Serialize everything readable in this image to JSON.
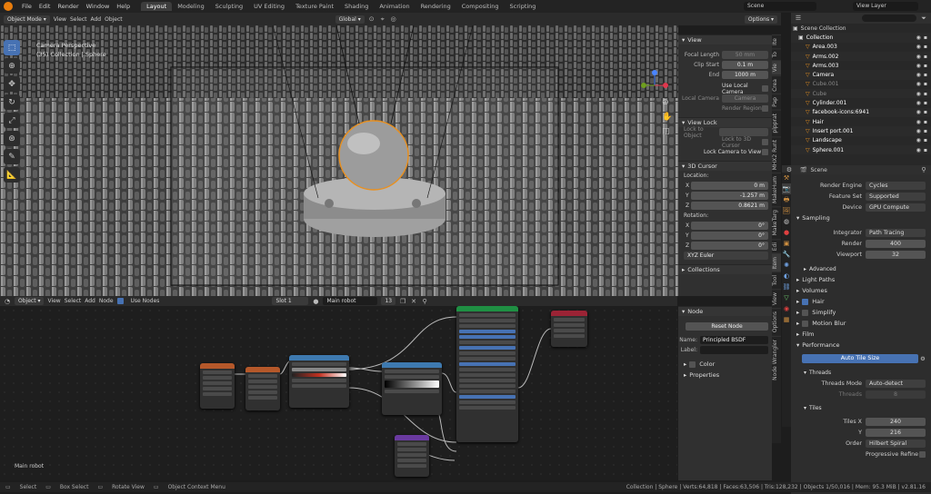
{
  "topbar": {
    "menus": [
      "File",
      "Edit",
      "Render",
      "Window",
      "Help"
    ],
    "workspaces": [
      "Layout",
      "Modeling",
      "Sculpting",
      "UV Editing",
      "Texture Paint",
      "Shading",
      "Animation",
      "Rendering",
      "Compositing",
      "Scripting"
    ],
    "active_workspace": "Layout",
    "scene": "Scene",
    "view_layer": "View Layer"
  },
  "viewport_header": {
    "mode": "Object Mode",
    "menus": [
      "View",
      "Select",
      "Add",
      "Object"
    ],
    "orientation": "Global",
    "options": "Options",
    "overlay_title": "Camera Perspective",
    "overlay_sub": "(35) Collection | Sphere"
  },
  "npanel": {
    "view_section": "View",
    "focal_length_label": "Focal Length",
    "focal_length": "50 mm",
    "clip_start_label": "Clip Start",
    "clip_start": "0.1 m",
    "end_label": "End",
    "end": "1000 m",
    "use_local_camera": "Use Local Camera",
    "local_camera_label": "Local Camera",
    "local_camera_value": "Camera",
    "render_region": "Render Region",
    "view_lock_section": "View Lock",
    "lock_to_object": "Lock to Object",
    "lock_to_3d_cursor": "Lock to 3D Cursor",
    "lock_camera_to_view": "Lock Camera to View",
    "cursor_section": "3D Cursor",
    "location_label": "Location:",
    "loc_x": "0 m",
    "loc_y": "-1.257 m",
    "loc_z": "0.8621 m",
    "rotation_label": "Rotation:",
    "rot_x": "0°",
    "rot_y": "0°",
    "rot_z": "0°",
    "rotation_mode": "XYZ Euler",
    "collections_section": "Collections"
  },
  "npanel_tabs": [
    "Ite",
    "To",
    "Vie",
    "Crea",
    "Pap",
    "plpprat",
    "MHX2 Runt",
    "MakeHum",
    "MakeTarg",
    "Edi",
    "Item",
    "Tool",
    "View",
    "Options",
    "Node Wrangler"
  ],
  "outliner": {
    "title": "Scene Collection",
    "items": [
      {
        "name": "Collection",
        "color": "#ffffff"
      },
      {
        "name": "Area.003",
        "color": "#ffffff"
      },
      {
        "name": "Arms.002",
        "color": "#ffffff"
      },
      {
        "name": "Arms.003",
        "color": "#ffffff"
      },
      {
        "name": "Camera",
        "color": "#ffffff"
      },
      {
        "name": "Cube.001",
        "color": "#888888"
      },
      {
        "name": "Cube",
        "color": "#888888"
      },
      {
        "name": "Cylinder.001",
        "color": "#ffffff"
      },
      {
        "name": "facebook-icons:6941",
        "color": "#ffffff"
      },
      {
        "name": "Hair",
        "color": "#ffffff"
      },
      {
        "name": "Insert port.001",
        "color": "#ffffff"
      },
      {
        "name": "Landscape",
        "color": "#ffffff"
      },
      {
        "name": "Sphere.001",
        "color": "#ffffff"
      }
    ]
  },
  "properties": {
    "scene": "Scene",
    "render_engine_label": "Render Engine",
    "render_engine": "Cycles",
    "feature_set_label": "Feature Set",
    "feature_set": "Supported",
    "device_label": "Device",
    "device": "GPU Compute",
    "sampling": "Sampling",
    "integrator_label": "Integrator",
    "integrator": "Path Tracing",
    "render_label": "Render",
    "render_samples": "400",
    "viewport_label": "Viewport",
    "viewport_samples": "32",
    "advanced": "Advanced",
    "light_paths": "Light Paths",
    "volumes": "Volumes",
    "hair": "Hair",
    "simplify": "Simplify",
    "motion_blur": "Motion Blur",
    "film": "Film",
    "performance": "Performance",
    "auto_tile_size": "Auto Tile Size",
    "threads": "Threads",
    "threads_mode_label": "Threads Mode",
    "threads_mode": "Auto-detect",
    "threads_count_label": "Threads",
    "threads_count": "8",
    "tiles": "Tiles",
    "tiles_x_label": "Tiles X",
    "tiles_x": "240",
    "tiles_y_label": "Y",
    "tiles_y": "216",
    "order_label": "Order",
    "order": "Hilbert Spiral",
    "progressive_refine": "Progressive Refine"
  },
  "node_header": {
    "type": "Object",
    "menus": [
      "View",
      "Select",
      "Add",
      "Node"
    ],
    "use_nodes": "Use Nodes",
    "slot": "Slot 1",
    "material": "Main robot",
    "users": "13",
    "footer_label": "Main robot"
  },
  "node_sidebar": {
    "section": "Node",
    "reset_node": "Reset Node",
    "name_label": "Name:",
    "name_value": "Principled BSDF",
    "label_label": "Label:",
    "color": "Color",
    "properties": "Properties"
  },
  "status": {
    "select": "Select",
    "box_select": "Box Select",
    "rotate_view": "Rotate View",
    "context_menu": "Object Context Menu",
    "stats": "Collection | Sphere | Verts:64,818 | Faces:63,506 | Tris:128,232 | Objects 1/50,016 | Mem: 95.3 MiB | v2.81.16"
  }
}
